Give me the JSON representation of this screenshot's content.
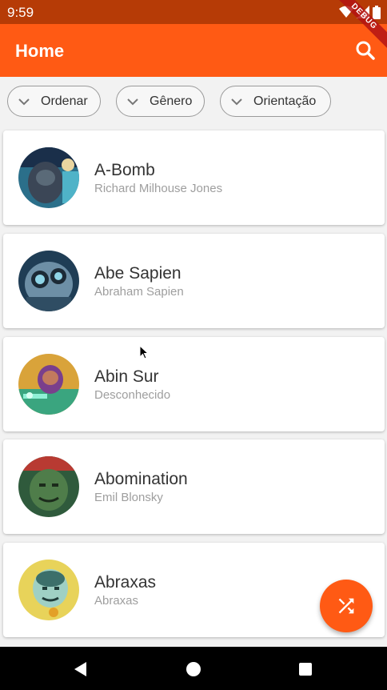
{
  "status_bar": {
    "time": "9:59",
    "icons": [
      "wifi-icon",
      "signal-icon",
      "battery-icon"
    ]
  },
  "debug_banner": "DEBUG",
  "app_bar": {
    "title": "Home",
    "search_icon": "search-icon"
  },
  "filters": [
    {
      "label": "Ordenar",
      "icon": "chevron-down-icon"
    },
    {
      "label": "Gênero",
      "icon": "chevron-down-icon"
    },
    {
      "label": "Orientação",
      "icon": "chevron-down-icon"
    }
  ],
  "heroes": [
    {
      "name": "A-Bomb",
      "real_name": "Richard Milhouse Jones"
    },
    {
      "name": "Abe Sapien",
      "real_name": "Abraham Sapien"
    },
    {
      "name": "Abin Sur",
      "real_name": "Desconhecido"
    },
    {
      "name": "Abomination",
      "real_name": "Emil Blonsky"
    },
    {
      "name": "Abraxas",
      "real_name": "Abraxas"
    }
  ],
  "fab": {
    "icon": "shuffle-icon"
  },
  "nav_bar": {
    "buttons": [
      "back-icon",
      "home-icon",
      "recents-icon"
    ]
  },
  "colors": {
    "primary": "#ff5a14",
    "status_bar": "#b63b06",
    "background": "#f2f2f2"
  }
}
